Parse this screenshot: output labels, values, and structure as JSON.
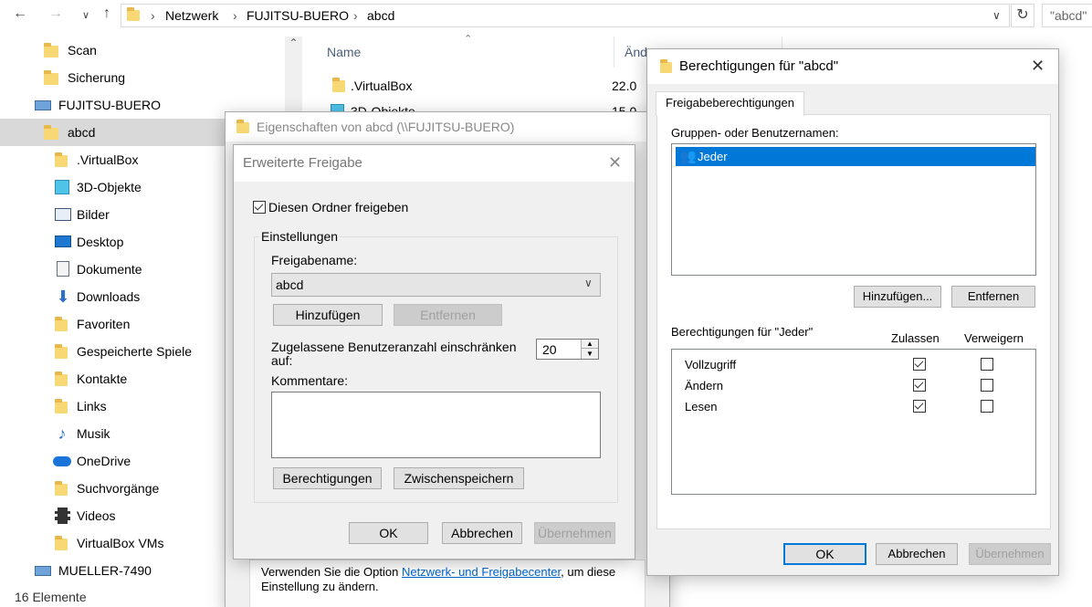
{
  "explorer": {
    "breadcrumb": [
      "Netzwerk",
      "FUJITSU-BUERO",
      "abcd"
    ],
    "search_placeholder": "\"abcd\"",
    "status": "16 Elemente",
    "nav_items": [
      {
        "label": "Scan",
        "icon": "folder-icon"
      },
      {
        "label": "Sicherung",
        "icon": "folder-icon"
      },
      {
        "label": "FUJITSU-BUERO",
        "icon": "computer-icon"
      },
      {
        "label": "abcd",
        "icon": "folder-icon"
      },
      {
        "label": ".VirtualBox",
        "icon": "folder-icon"
      },
      {
        "label": "3D-Objekte",
        "icon": "3d-objects-icon"
      },
      {
        "label": "Bilder",
        "icon": "pictures-icon"
      },
      {
        "label": "Desktop",
        "icon": "desktop-icon"
      },
      {
        "label": "Dokumente",
        "icon": "documents-icon"
      },
      {
        "label": "Downloads",
        "icon": "downloads-icon"
      },
      {
        "label": "Favoriten",
        "icon": "favorites-icon"
      },
      {
        "label": "Gespeicherte Spiele",
        "icon": "saved-games-icon"
      },
      {
        "label": "Kontakte",
        "icon": "contacts-icon"
      },
      {
        "label": "Links",
        "icon": "links-icon"
      },
      {
        "label": "Musik",
        "icon": "music-icon"
      },
      {
        "label": "OneDrive",
        "icon": "onedrive-icon"
      },
      {
        "label": "Suchvorgänge",
        "icon": "searches-icon"
      },
      {
        "label": "Videos",
        "icon": "videos-icon"
      },
      {
        "label": "VirtualBox VMs",
        "icon": "folder-icon"
      },
      {
        "label": "MUELLER-7490",
        "icon": "computer-icon"
      }
    ],
    "columns": {
      "name": "Name",
      "changed": "Änd"
    },
    "files": [
      {
        "name": ".VirtualBox",
        "date": "22.0"
      },
      {
        "name": "3D-Objekte",
        "date": "15.0"
      }
    ]
  },
  "properties_dialog": {
    "title": "Eigenschaften von abcd (\\\\FUJITSU-BUERO)",
    "note_prefix": "Verwenden Sie die Option",
    "note_link": "Netzwerk- und Freigabecenter",
    "note_suffix": ", um diese",
    "note_line2": "Einstellung zu ändern."
  },
  "advanced_share": {
    "title": "Erweiterte Freigabe",
    "share_checkbox_label": "Diesen Ordner freigeben",
    "share_checked": true,
    "settings_group": "Einstellungen",
    "share_name_label": "Freigabename:",
    "share_name_value": "abcd",
    "add_button": "Hinzufügen",
    "remove_button": "Entfernen",
    "user_limit_label_line1": "Zugelassene Benutzeranzahl einschränken",
    "user_limit_label_line2": "auf:",
    "user_limit_value": "20",
    "comments_label": "Kommentare:",
    "permissions_button": "Berechtigungen",
    "caching_button": "Zwischenspeichern",
    "ok_button": "OK",
    "cancel_button": "Abbrechen",
    "apply_button": "Übernehmen"
  },
  "permissions_dialog": {
    "title": "Berechtigungen für \"abcd\"",
    "tab": "Freigabeberechtigungen",
    "groups_label": "Gruppen- oder Benutzernamen:",
    "group_selected": "Jeder",
    "add_button": "Hinzufügen...",
    "remove_button": "Entfernen",
    "perm_for_label": "Berechtigungen für \"Jeder\"",
    "allow_header": "Zulassen",
    "deny_header": "Verweigern",
    "permissions": [
      {
        "name": "Vollzugriff",
        "allow": true,
        "deny": false
      },
      {
        "name": "Ändern",
        "allow": true,
        "deny": false
      },
      {
        "name": "Lesen",
        "allow": true,
        "deny": false
      }
    ],
    "ok_button": "OK",
    "cancel_button": "Abbrechen",
    "apply_button": "Übernehmen"
  }
}
